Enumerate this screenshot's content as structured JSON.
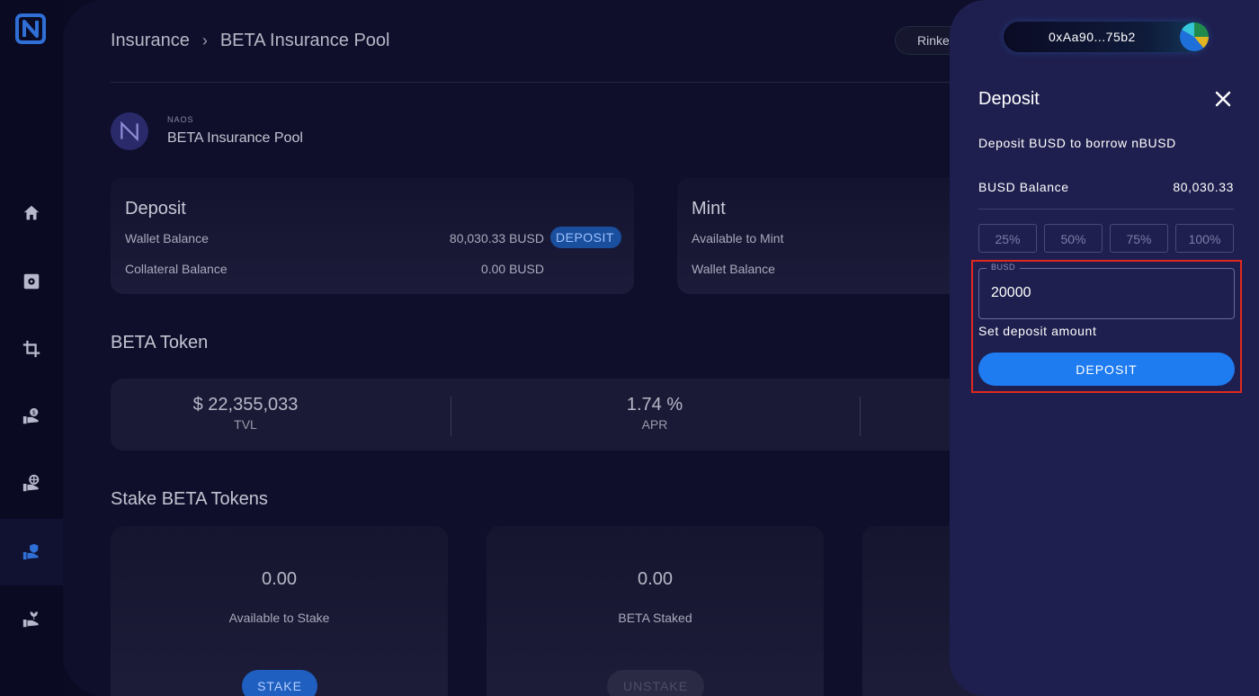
{
  "breadcrumb": {
    "root": "Insurance",
    "separator": "›",
    "current": "BETA Insurance Pool"
  },
  "network": {
    "label": "Rinkeby"
  },
  "pool": {
    "org": "NAOS",
    "name": "BETA Insurance Pool"
  },
  "deposit_card": {
    "title": "Deposit",
    "wallet_balance_label": "Wallet Balance",
    "wallet_balance_value": "80,030.33 BUSD",
    "deposit_button": "DEPOSIT",
    "collateral_label": "Collateral Balance",
    "collateral_value": "0.00 BUSD"
  },
  "mint_card": {
    "title": "Mint",
    "available_label": "Available to Mint",
    "wallet_label": "Wallet Balance"
  },
  "token_section": {
    "title": "BETA Token",
    "stats": [
      {
        "value": "$ 22,355,033",
        "label": "TVL"
      },
      {
        "value": "1.74 %",
        "label": "APR"
      }
    ]
  },
  "stake_section": {
    "title": "Stake BETA Tokens",
    "cards": [
      {
        "value": "0.00",
        "label": "Available to Stake",
        "button": "STAKE"
      },
      {
        "value": "0.00",
        "label": "BETA Staked",
        "button": "UNSTAKE"
      }
    ]
  },
  "drawer": {
    "wallet_address": "0xAa90...75b2",
    "title": "Deposit",
    "subtitle": "Deposit BUSD to borrow nBUSD",
    "balance_label": "BUSD Balance",
    "balance_value": "80,030.33",
    "percent_buttons": [
      "25%",
      "50%",
      "75%",
      "100%"
    ],
    "amount_legend": "BUSD",
    "amount_value": "20000",
    "helper_text": "Set deposit amount",
    "deposit_button": "DEPOSIT"
  },
  "colors": {
    "accent": "#1e7bf0",
    "highlight": "#e0281f",
    "drawer_bg": "#1f1f4f",
    "main_bg": "#0f0f2c"
  },
  "icons": {
    "sidebar": [
      "home-icon",
      "vault-icon",
      "crop-icon",
      "hand-dollar-icon",
      "hand-globe-icon",
      "hand-shield-icon",
      "hand-plant-icon"
    ]
  }
}
